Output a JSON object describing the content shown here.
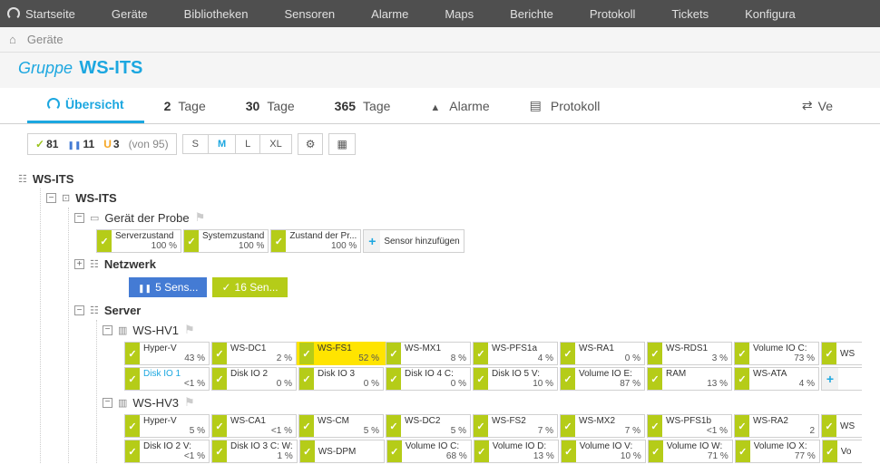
{
  "topnav": [
    "Startseite",
    "Geräte",
    "Bibliotheken",
    "Sensoren",
    "Alarme",
    "Maps",
    "Berichte",
    "Protokoll",
    "Tickets",
    "Konfigura"
  ],
  "breadcrumb": {
    "items": [
      "Geräte"
    ]
  },
  "page": {
    "prefix": "Gruppe",
    "title": "WS-ITS"
  },
  "tabs": {
    "overview": "Übersicht",
    "d2": {
      "num": "2",
      "label": "Tage"
    },
    "d30": {
      "num": "30",
      "label": "Tage"
    },
    "d365": {
      "num": "365",
      "label": "Tage"
    },
    "alarms": "Alarme",
    "protocol": "Protokoll",
    "compare": "Ve"
  },
  "toolbar": {
    "counts": {
      "ok": "81",
      "paused": "11",
      "warn": "3",
      "total": "(von 95)"
    },
    "sizes": [
      "S",
      "M",
      "L",
      "XL"
    ]
  },
  "tree": {
    "root": "WS-ITS",
    "sub": "WS-ITS",
    "probe": {
      "label": "Gerät der Probe",
      "sensors": [
        {
          "name": "Serverzustand",
          "val": "100 %",
          "status": "ok"
        },
        {
          "name": "Systemzustand",
          "val": "100 %",
          "status": "ok"
        },
        {
          "name": "Zustand der Pr...",
          "val": "100 %",
          "status": "ok"
        }
      ],
      "add": "Sensor hinzufügen"
    },
    "netzwerk": {
      "label": "Netzwerk",
      "pills": [
        {
          "type": "blue",
          "text": "5 Sens..."
        },
        {
          "type": "green",
          "text": "16 Sen..."
        }
      ]
    },
    "server": {
      "label": "Server",
      "hosts": [
        {
          "name": "WS-HV1",
          "rows": [
            [
              {
                "name": "Hyper-V",
                "val": "43 %",
                "status": "ok"
              },
              {
                "name": "WS-DC1",
                "val": "2 %",
                "status": "ok"
              },
              {
                "name": "WS-FS1",
                "val": "52 %",
                "status": "ok",
                "highlight": true
              },
              {
                "name": "WS-MX1",
                "val": "8 %",
                "status": "ok"
              },
              {
                "name": "WS-PFS1a",
                "val": "4 %",
                "status": "ok"
              },
              {
                "name": "WS-RA1",
                "val": "0 %",
                "status": "ok"
              },
              {
                "name": "WS-RDS1",
                "val": "3 %",
                "status": "ok"
              },
              {
                "name": "Volume IO C:",
                "val": "73 %",
                "status": "ok"
              },
              {
                "name": "WS",
                "val": "",
                "status": "ok"
              }
            ],
            [
              {
                "name": "Disk IO 1",
                "val": "<1 %",
                "status": "ok",
                "link": true
              },
              {
                "name": "Disk IO 2",
                "val": "0 %",
                "status": "ok"
              },
              {
                "name": "Disk IO 3",
                "val": "0 %",
                "status": "ok"
              },
              {
                "name": "Disk IO 4 C:",
                "val": "0 %",
                "status": "ok"
              },
              {
                "name": "Disk IO 5 V:",
                "val": "10 %",
                "status": "ok"
              },
              {
                "name": "Volume IO E:",
                "val": "87 %",
                "status": "ok"
              },
              {
                "name": "RAM",
                "val": "13 %",
                "status": "ok"
              },
              {
                "name": "WS-ATA",
                "val": "4 %",
                "status": "ok"
              },
              {
                "name": "",
                "val": "",
                "status": "add"
              }
            ]
          ]
        },
        {
          "name": "WS-HV3",
          "rows": [
            [
              {
                "name": "Hyper-V",
                "val": "5 %",
                "status": "ok"
              },
              {
                "name": "WS-CA1",
                "val": "<1 %",
                "status": "ok"
              },
              {
                "name": "WS-CM",
                "val": "5 %",
                "status": "ok"
              },
              {
                "name": "WS-DC2",
                "val": "5 %",
                "status": "ok"
              },
              {
                "name": "WS-FS2",
                "val": "7 %",
                "status": "ok"
              },
              {
                "name": "WS-MX2",
                "val": "7 %",
                "status": "ok"
              },
              {
                "name": "WS-PFS1b",
                "val": "<1 %",
                "status": "ok"
              },
              {
                "name": "WS-RA2",
                "val": "2",
                "status": "ok"
              },
              {
                "name": "WS",
                "val": "",
                "status": "ok"
              }
            ],
            [
              {
                "name": "Disk IO 2 V:",
                "val": "<1 %",
                "status": "ok"
              },
              {
                "name": "Disk IO 3 C: W:",
                "val": "1 %",
                "status": "ok"
              },
              {
                "name": "WS-DPM",
                "val": "",
                "status": "ok"
              },
              {
                "name": "Volume IO C:",
                "val": "68 %",
                "status": "ok"
              },
              {
                "name": "Volume IO D:",
                "val": "13 %",
                "status": "ok"
              },
              {
                "name": "Volume IO V:",
                "val": "10 %",
                "status": "ok"
              },
              {
                "name": "Volume IO W:",
                "val": "71 %",
                "status": "ok"
              },
              {
                "name": "Volume IO X:",
                "val": "77 %",
                "status": "ok"
              },
              {
                "name": "Vo",
                "val": "",
                "status": "ok"
              }
            ]
          ]
        }
      ]
    }
  }
}
